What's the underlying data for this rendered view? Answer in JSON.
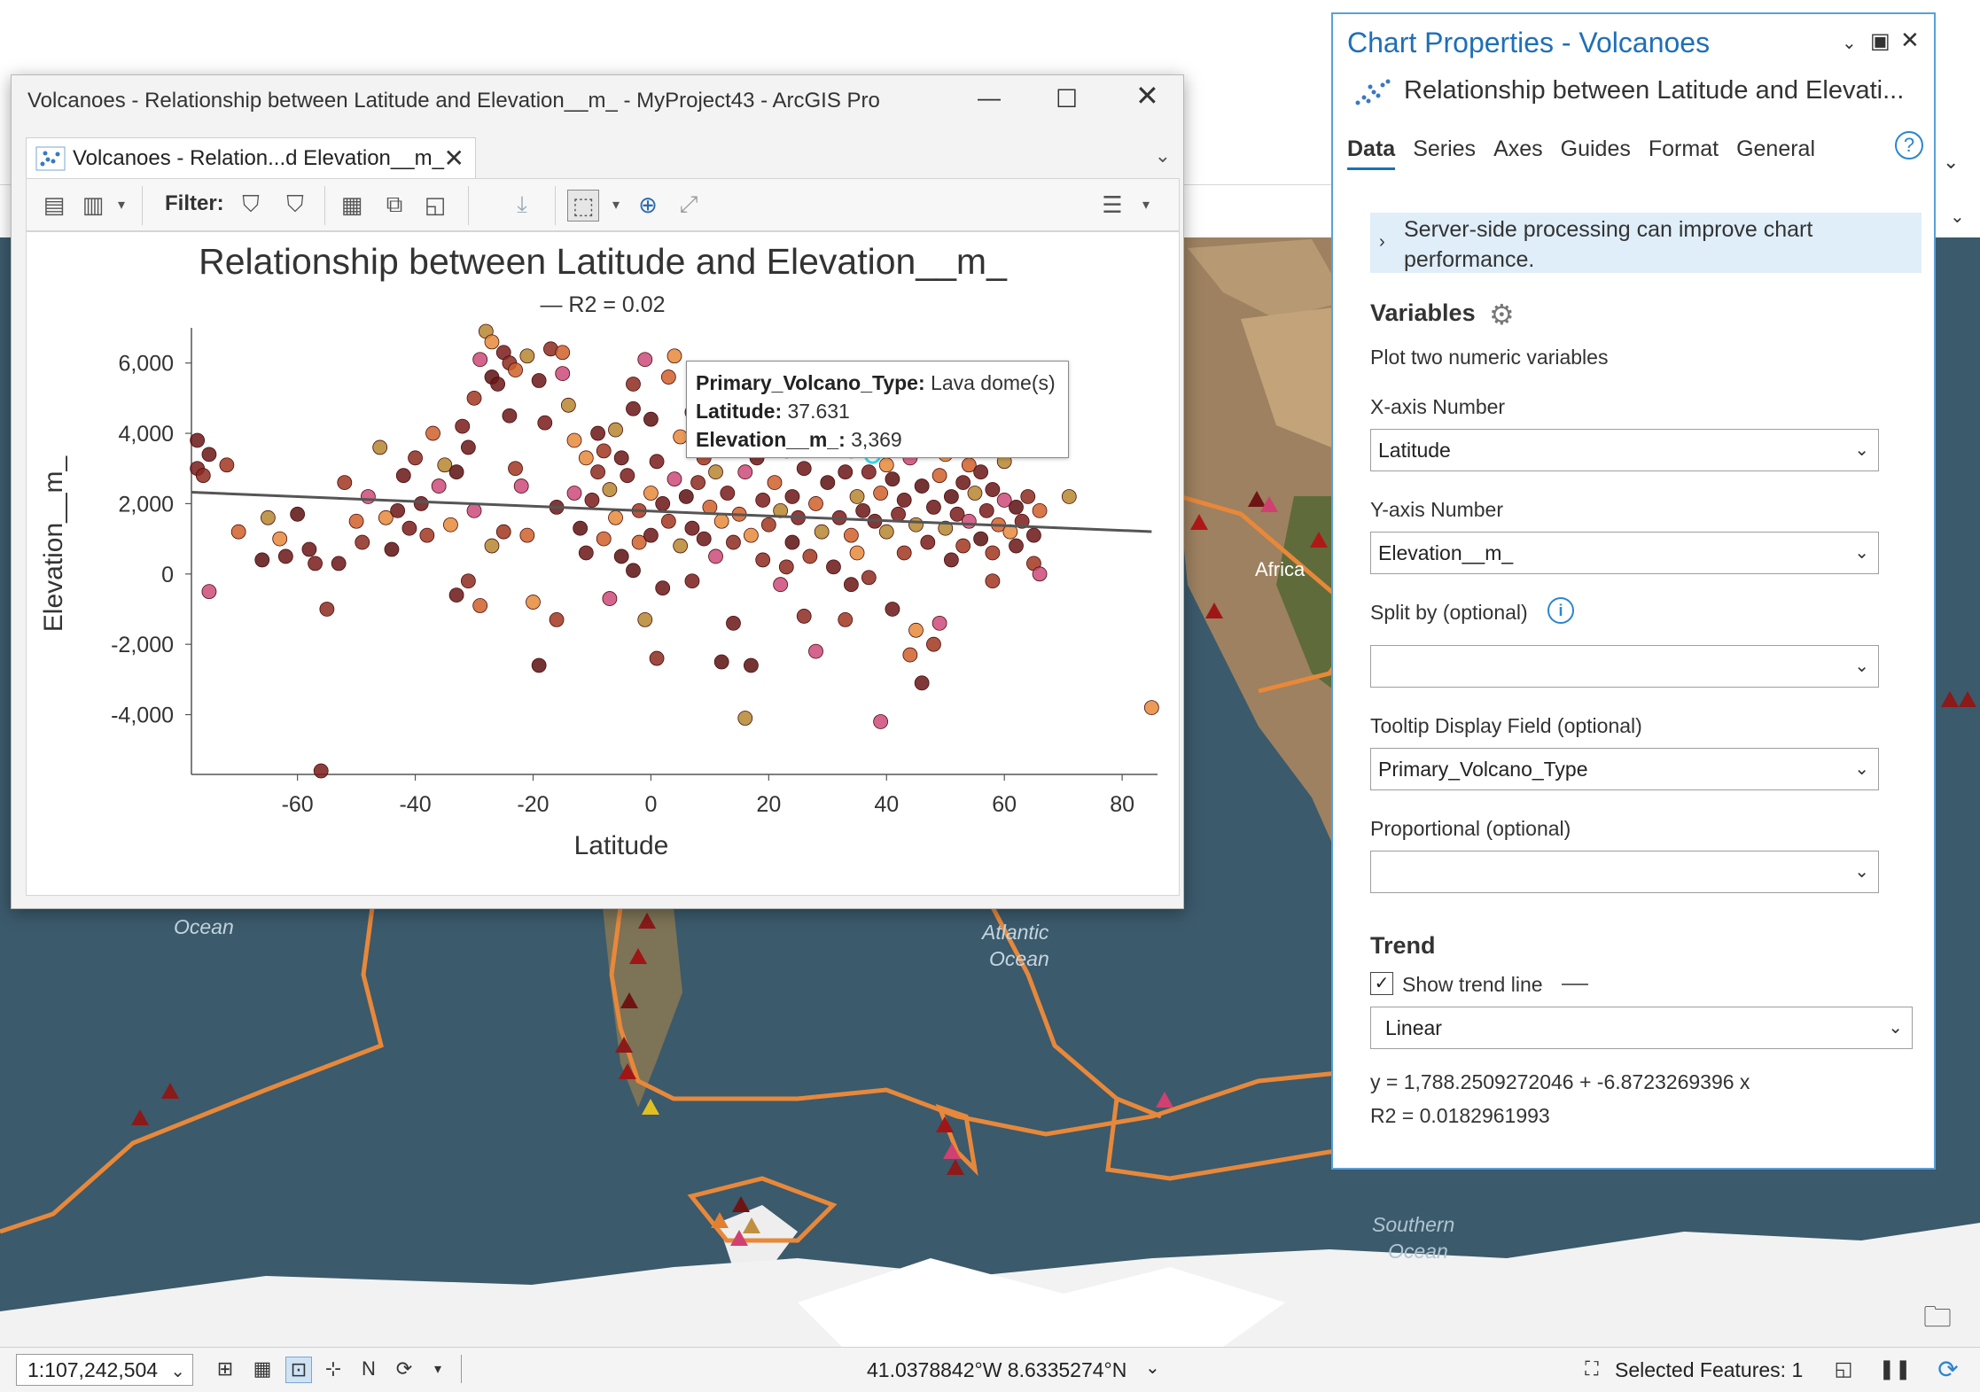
{
  "map": {
    "labels": [
      "Africa",
      "Atlantic",
      "Ocean",
      "Southern",
      "Ocean",
      "Ocean"
    ],
    "colors": {
      "land": "#8f7553",
      "ocean": "#3c586a",
      "ice": "#f4f4f4",
      "plate": "#e88a3c"
    }
  },
  "status": {
    "scale": "1:107,242,504",
    "coords": "41.0378842°W 8.6335274°N",
    "selected_features": "Selected Features: 1"
  },
  "chart_window": {
    "title": "Volcanoes - Relationship between Latitude and Elevation__m_ - MyProject43 - ArcGIS Pro",
    "tab_label": "Volcanoes - Relation...d Elevation__m_",
    "filter_label": "Filter:"
  },
  "tooltip": {
    "k1": "Primary_Volcano_Type:",
    "v1": " Lava dome(s)",
    "k2": "Latitude:",
    "v2": " 37.631",
    "k3": "Elevation__m_:",
    "v3": " 3,369"
  },
  "chart_data": {
    "type": "scatter",
    "title": "Relationship between Latitude and Elevation__m_",
    "legend": "— R2 = 0.02",
    "xlabel": "Latitude",
    "ylabel": "Elevation__m_",
    "xlim": [
      -78,
      86
    ],
    "ylim": [
      -5700,
      7000
    ],
    "xticks": [
      -60,
      -40,
      -20,
      0,
      20,
      40,
      60,
      80
    ],
    "xtick_labels": [
      "-60",
      "-40",
      "-20",
      "0",
      "20",
      "40",
      "60",
      "80"
    ],
    "yticks": [
      6000,
      4000,
      2000,
      0,
      -2000,
      -4000
    ],
    "ytick_labels": [
      "6,000",
      "4,000",
      "2,000",
      "0",
      "-2,000",
      "-4,000"
    ],
    "trend": {
      "intercept": 1788.25,
      "slope": -6.8723
    },
    "highlight": {
      "x": 37.631,
      "y": 3369
    },
    "points": [
      {
        "x": -77,
        "y": 3800
      },
      {
        "x": -77,
        "y": 3000
      },
      {
        "x": -76,
        "y": 2800
      },
      {
        "x": -75,
        "y": 3400
      },
      {
        "x": -72,
        "y": 3100
      },
      {
        "x": -70,
        "y": 1200
      },
      {
        "x": -75,
        "y": -500
      },
      {
        "x": -65,
        "y": 1600
      },
      {
        "x": -63,
        "y": 1000
      },
      {
        "x": -60,
        "y": 1700
      },
      {
        "x": -58,
        "y": 700
      },
      {
        "x": -56,
        "y": -5600
      },
      {
        "x": -55,
        "y": -1000
      },
      {
        "x": -53,
        "y": 300
      },
      {
        "x": -52,
        "y": 2600
      },
      {
        "x": -50,
        "y": 1500
      },
      {
        "x": -48,
        "y": 2200
      },
      {
        "x": -46,
        "y": 3600
      },
      {
        "x": -45,
        "y": 1600
      },
      {
        "x": -44,
        "y": 700
      },
      {
        "x": -42,
        "y": 2800
      },
      {
        "x": -41,
        "y": 1300
      },
      {
        "x": -40,
        "y": 3300
      },
      {
        "x": -39,
        "y": 2000
      },
      {
        "x": -38,
        "y": 1100
      },
      {
        "x": -37,
        "y": 4000
      },
      {
        "x": -36,
        "y": 2500
      },
      {
        "x": -35,
        "y": 3100
      },
      {
        "x": -34,
        "y": 1400
      },
      {
        "x": -33,
        "y": 2900
      },
      {
        "x": -33,
        "y": -600
      },
      {
        "x": -32,
        "y": 4200
      },
      {
        "x": -31,
        "y": -200
      },
      {
        "x": -31,
        "y": 3600
      },
      {
        "x": -30,
        "y": 5000
      },
      {
        "x": -29,
        "y": -900
      },
      {
        "x": -29,
        "y": 6100
      },
      {
        "x": -28,
        "y": 6900
      },
      {
        "x": -27,
        "y": 6600
      },
      {
        "x": -27,
        "y": 5600
      },
      {
        "x": -26,
        "y": 5400
      },
      {
        "x": -25,
        "y": 6300
      },
      {
        "x": -24,
        "y": 6000
      },
      {
        "x": -24,
        "y": 4500
      },
      {
        "x": -23,
        "y": 3000
      },
      {
        "x": -23,
        "y": 5800
      },
      {
        "x": -22,
        "y": 2500
      },
      {
        "x": -21,
        "y": 6200
      },
      {
        "x": -20,
        "y": -800
      },
      {
        "x": -19,
        "y": -2600
      },
      {
        "x": -19,
        "y": 5500
      },
      {
        "x": -18,
        "y": 4300
      },
      {
        "x": -17,
        "y": 6400
      },
      {
        "x": -16,
        "y": 1900
      },
      {
        "x": -16,
        "y": -1300
      },
      {
        "x": -15,
        "y": 6300
      },
      {
        "x": -15,
        "y": 5700
      },
      {
        "x": -14,
        "y": 4800
      },
      {
        "x": -13,
        "y": 3800
      },
      {
        "x": -12,
        "y": 1300
      },
      {
        "x": -11,
        "y": 600
      },
      {
        "x": -10,
        "y": 2100
      },
      {
        "x": -9,
        "y": 2900
      },
      {
        "x": -9,
        "y": 4000
      },
      {
        "x": -8,
        "y": 3500
      },
      {
        "x": -8,
        "y": 1000
      },
      {
        "x": -7,
        "y": -700
      },
      {
        "x": -7,
        "y": 2400
      },
      {
        "x": -6,
        "y": 1600
      },
      {
        "x": -5,
        "y": 500
      },
      {
        "x": -5,
        "y": 3300
      },
      {
        "x": -4,
        "y": 2800
      },
      {
        "x": -3,
        "y": 5400
      },
      {
        "x": -3,
        "y": 4700
      },
      {
        "x": -2,
        "y": 1800
      },
      {
        "x": -2,
        "y": 900
      },
      {
        "x": -1,
        "y": 6100
      },
      {
        "x": -1,
        "y": -1300
      },
      {
        "x": 0,
        "y": 2300
      },
      {
        "x": 0,
        "y": 4400
      },
      {
        "x": 0,
        "y": 1100
      },
      {
        "x": 1,
        "y": 3200
      },
      {
        "x": 1,
        "y": -2400
      },
      {
        "x": 2,
        "y": 2000
      },
      {
        "x": 3,
        "y": 1500
      },
      {
        "x": 3,
        "y": 5600
      },
      {
        "x": 4,
        "y": 2700
      },
      {
        "x": 5,
        "y": 800
      },
      {
        "x": 5,
        "y": 3900
      },
      {
        "x": 6,
        "y": 2200
      },
      {
        "x": 7,
        "y": 1300
      },
      {
        "x": 7,
        "y": 4600
      },
      {
        "x": 8,
        "y": 2600
      },
      {
        "x": 9,
        "y": 1000
      },
      {
        "x": 9,
        "y": 3300
      },
      {
        "x": 10,
        "y": 1900
      },
      {
        "x": 11,
        "y": 500
      },
      {
        "x": 11,
        "y": 2900
      },
      {
        "x": 12,
        "y": 1500
      },
      {
        "x": 12,
        "y": -2500
      },
      {
        "x": 13,
        "y": 3700
      },
      {
        "x": 13,
        "y": 2300
      },
      {
        "x": 14,
        "y": 900
      },
      {
        "x": 14,
        "y": -1400
      },
      {
        "x": 15,
        "y": 4700
      },
      {
        "x": 15,
        "y": 1700
      },
      {
        "x": 16,
        "y": 2900
      },
      {
        "x": 16,
        "y": -4100
      },
      {
        "x": 17,
        "y": 1100
      },
      {
        "x": 17,
        "y": -2600
      },
      {
        "x": 18,
        "y": 3300
      },
      {
        "x": 19,
        "y": 2100
      },
      {
        "x": 19,
        "y": 400
      },
      {
        "x": 20,
        "y": 4300
      },
      {
        "x": 20,
        "y": 1400
      },
      {
        "x": 21,
        "y": 2600
      },
      {
        "x": 22,
        "y": -300
      },
      {
        "x": 22,
        "y": 1800
      },
      {
        "x": 23,
        "y": 3500
      },
      {
        "x": 24,
        "y": 900
      },
      {
        "x": 24,
        "y": 2200
      },
      {
        "x": 25,
        "y": 1600
      },
      {
        "x": 26,
        "y": -1200
      },
      {
        "x": 26,
        "y": 3000
      },
      {
        "x": 27,
        "y": 500
      },
      {
        "x": 28,
        "y": 2000
      },
      {
        "x": 28,
        "y": -2200
      },
      {
        "x": 29,
        "y": 1200
      },
      {
        "x": 30,
        "y": 3800
      },
      {
        "x": 30,
        "y": 2600
      },
      {
        "x": 31,
        "y": 200
      },
      {
        "x": 32,
        "y": 1600
      },
      {
        "x": 32,
        "y": 4600
      },
      {
        "x": 33,
        "y": 2900
      },
      {
        "x": 33,
        "y": -1300
      },
      {
        "x": 34,
        "y": 1100
      },
      {
        "x": 34,
        "y": 3500
      },
      {
        "x": 35,
        "y": 2200
      },
      {
        "x": 35,
        "y": 600
      },
      {
        "x": 36,
        "y": 5100
      },
      {
        "x": 36,
        "y": 1800
      },
      {
        "x": 37,
        "y": 2900
      },
      {
        "x": 37,
        "y": -100
      },
      {
        "x": 38,
        "y": 1500
      },
      {
        "x": 38,
        "y": 4200
      },
      {
        "x": 39,
        "y": 2300
      },
      {
        "x": 39,
        "y": -4200
      },
      {
        "x": 40,
        "y": 1200
      },
      {
        "x": 40,
        "y": 3100
      },
      {
        "x": 41,
        "y": 2700
      },
      {
        "x": 41,
        "y": -1000
      },
      {
        "x": 42,
        "y": 1700
      },
      {
        "x": 42,
        "y": 4400
      },
      {
        "x": 43,
        "y": 2100
      },
      {
        "x": 43,
        "y": 600
      },
      {
        "x": 44,
        "y": -2300
      },
      {
        "x": 44,
        "y": 3300
      },
      {
        "x": 45,
        "y": 1400
      },
      {
        "x": 45,
        "y": -1600
      },
      {
        "x": 46,
        "y": 2500
      },
      {
        "x": 46,
        "y": -3100
      },
      {
        "x": 47,
        "y": 900
      },
      {
        "x": 47,
        "y": 3700
      },
      {
        "x": 48,
        "y": 1900
      },
      {
        "x": 48,
        "y": -2000
      },
      {
        "x": 49,
        "y": 2800
      },
      {
        "x": 49,
        "y": -1400
      },
      {
        "x": 50,
        "y": 1300
      },
      {
        "x": 50,
        "y": 3400
      },
      {
        "x": 51,
        "y": 2200
      },
      {
        "x": 51,
        "y": 400
      },
      {
        "x": 52,
        "y": 1700
      },
      {
        "x": 52,
        "y": 4500
      },
      {
        "x": 53,
        "y": 2600
      },
      {
        "x": 53,
        "y": 800
      },
      {
        "x": 54,
        "y": 3100
      },
      {
        "x": 54,
        "y": 1500
      },
      {
        "x": 55,
        "y": 2300
      },
      {
        "x": 55,
        "y": 4700
      },
      {
        "x": 56,
        "y": 1000
      },
      {
        "x": 56,
        "y": 2900
      },
      {
        "x": 57,
        "y": 1800
      },
      {
        "x": 57,
        "y": 3600
      },
      {
        "x": 58,
        "y": 2400
      },
      {
        "x": 58,
        "y": 600
      },
      {
        "x": 59,
        "y": 1400
      },
      {
        "x": 60,
        "y": 2100
      },
      {
        "x": 60,
        "y": 3200
      },
      {
        "x": 61,
        "y": 1200
      },
      {
        "x": 62,
        "y": 1900
      },
      {
        "x": 62,
        "y": 800
      },
      {
        "x": 63,
        "y": 1500
      },
      {
        "x": 64,
        "y": 2200
      },
      {
        "x": 65,
        "y": 1100
      },
      {
        "x": 65,
        "y": 300
      },
      {
        "x": 66,
        "y": 1800
      },
      {
        "x": 66,
        "y": 0
      },
      {
        "x": 71,
        "y": 2200
      },
      {
        "x": 85,
        "y": -3800
      },
      {
        "x": -66,
        "y": 400
      },
      {
        "x": -62,
        "y": 500
      },
      {
        "x": -57,
        "y": 300
      },
      {
        "x": -49,
        "y": 900
      },
      {
        "x": -43,
        "y": 1800
      },
      {
        "x": -25,
        "y": 1200
      },
      {
        "x": -21,
        "y": 1100
      },
      {
        "x": -13,
        "y": 2300
      },
      {
        "x": -6,
        "y": 4100
      },
      {
        "x": 4,
        "y": 6200
      },
      {
        "x": 9,
        "y": 5200
      },
      {
        "x": 12,
        "y": 5600
      },
      {
        "x": 18,
        "y": 5000
      },
      {
        "x": 27,
        "y": 5500
      },
      {
        "x": 45,
        "y": 4800
      },
      {
        "x": 49,
        "y": 4300
      },
      {
        "x": 56,
        "y": 5000
      },
      {
        "x": -30,
        "y": 1800
      },
      {
        "x": -27,
        "y": 800
      },
      {
        "x": -11,
        "y": 3300
      },
      {
        "x": -3,
        "y": 100
      },
      {
        "x": 2,
        "y": -400
      },
      {
        "x": 7,
        "y": -200
      },
      {
        "x": 23,
        "y": 200
      },
      {
        "x": 34,
        "y": -300
      },
      {
        "x": 58,
        "y": -200
      }
    ]
  },
  "props": {
    "title": "Chart Properties - Volcanoes",
    "subtitle": "Relationship between Latitude and Elevati...",
    "tabs": [
      "Data",
      "Series",
      "Axes",
      "Guides",
      "Format",
      "General"
    ],
    "info_line1": "Server-side processing can improve chart",
    "info_line2": "performance.",
    "variables_h": "Variables",
    "variables_txt": "Plot two numeric variables",
    "x_label": "X-axis Number",
    "x_value": "Latitude",
    "y_label": "Y-axis Number",
    "y_value": "Elevation__m_",
    "split_label": "Split by (optional)",
    "split_value": "",
    "tooltip_label": "Tooltip Display Field (optional)",
    "tooltip_value": "Primary_Volcano_Type",
    "prop_label": "Proportional (optional)",
    "prop_value": "",
    "trend_h": "Trend",
    "show_trend": "Show trend line",
    "trend_type": "Linear",
    "equation": "y = 1,788.2509272046 + -6.8723269396 x",
    "r2": "R2 = 0.0182961993"
  }
}
